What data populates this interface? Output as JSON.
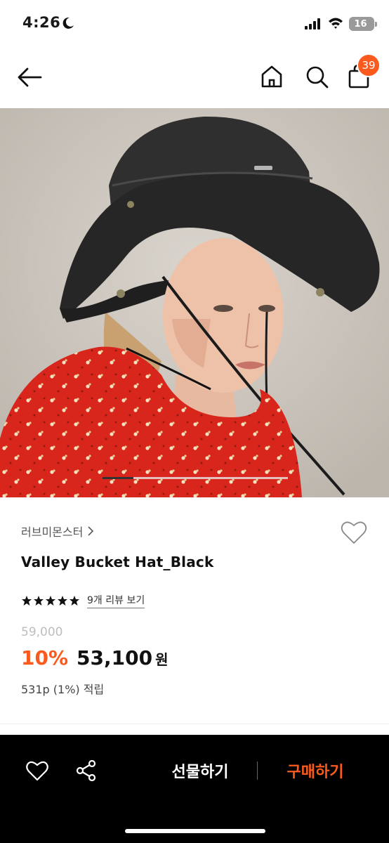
{
  "status_bar": {
    "time": "4:26",
    "battery": "16"
  },
  "nav": {
    "cart_count": "39"
  },
  "product": {
    "brand": "러브미몬스터",
    "title": "Valley Bucket Hat_Black",
    "rating_stars": 5,
    "review_link": "9개 리뷰 보기",
    "original_price": "59,000",
    "discount": "10%",
    "sale_price": "53,100",
    "currency": "원",
    "points": "531p (1%) 적립",
    "image_carousel": {
      "active_index": 0
    }
  },
  "bottom_bar": {
    "gift_label": "선물하기",
    "buy_label": "구매하기"
  },
  "colors": {
    "accent": "#fb5a1e",
    "bottom_bar_bg": "#000000"
  }
}
